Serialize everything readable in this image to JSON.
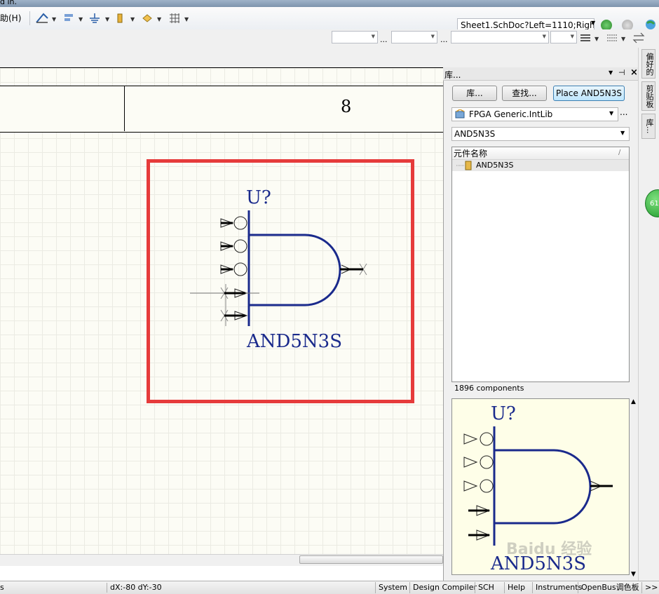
{
  "window": {
    "title_fragment": "d in."
  },
  "menu": {
    "help_label": "助(H)"
  },
  "toolbar": {
    "document_path": "Sheet1.SchDoc?Left=1110;Right",
    "ellipsis_1": "...",
    "ellipsis_2": "..."
  },
  "sheet": {
    "zone_number": "8"
  },
  "component": {
    "designator": "U?",
    "comment": "AND5N3S"
  },
  "libraries_panel": {
    "title": "库...",
    "buttons": {
      "libraries": "库...",
      "search": "查找...",
      "place": "Place AND5N3S"
    },
    "library_selected": "FPGA Generic.IntLib",
    "more_label": "...",
    "filter_value": "AND5N3S",
    "list_header": "元件名称",
    "list_items": [
      "AND5N3S"
    ],
    "component_count": "1896 components",
    "preview": {
      "designator": "U?",
      "comment": "AND5N3S"
    }
  },
  "dock_tabs": [
    "偏好的",
    "剪贴板",
    "库..."
  ],
  "badge": {
    "value": "61"
  },
  "status_bar": {
    "left_text": "s",
    "coords": "dX:-80 dY:-30",
    "panels": [
      "System",
      "Design Compiler",
      "SCH",
      "Help",
      "Instruments",
      "OpenBus调色板",
      ">>"
    ]
  },
  "watermark": {
    "text": "Baidu 经验"
  },
  "colors": {
    "highlight": "#e63b3b",
    "symbol": "#1a2a8c",
    "sheet": "#fcfcf5",
    "preview": "#fefee8"
  }
}
